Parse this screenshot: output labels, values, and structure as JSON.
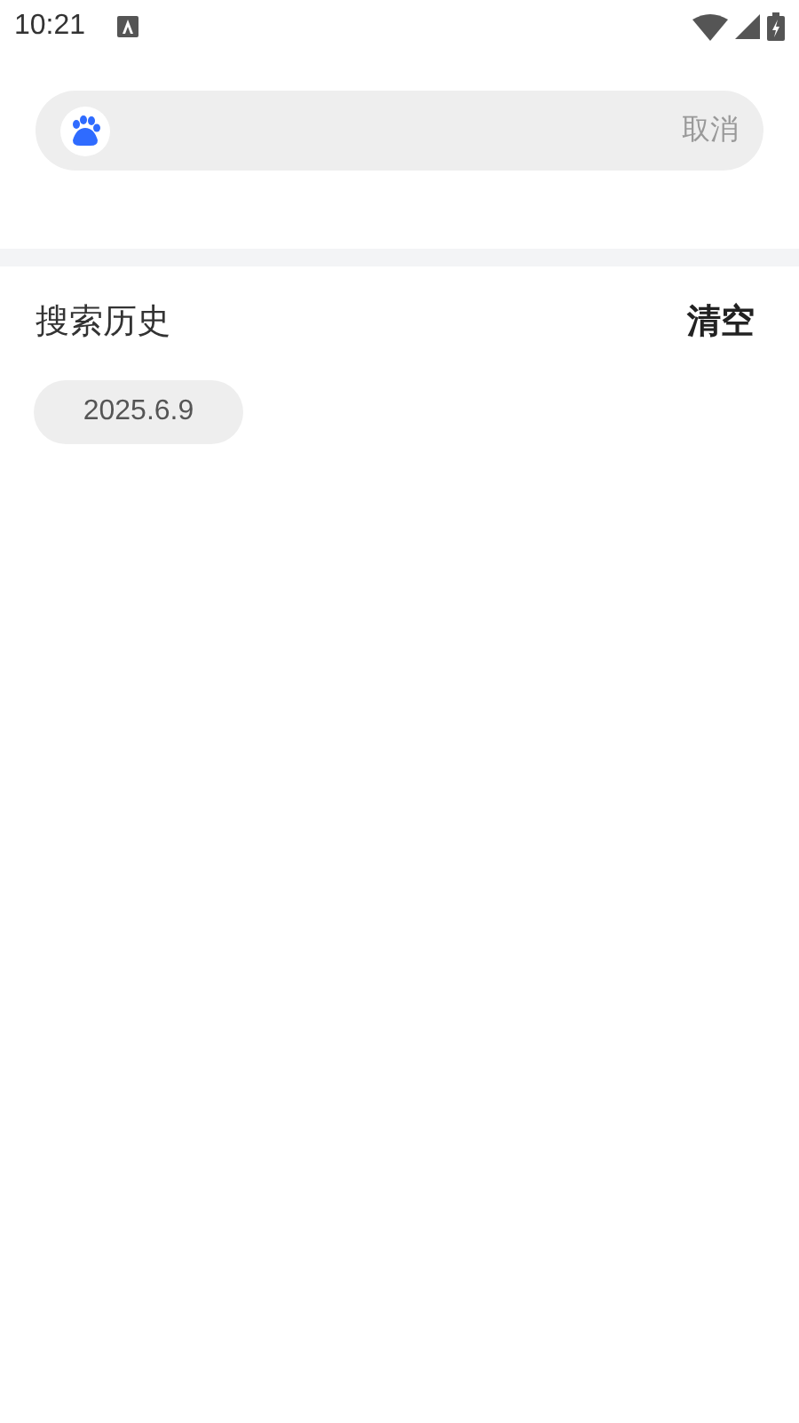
{
  "status_bar": {
    "time": "10:21"
  },
  "search": {
    "cancel": "取消"
  },
  "history": {
    "title": "搜索历史",
    "clear": "清空",
    "items": [
      "2025.6.9"
    ]
  }
}
